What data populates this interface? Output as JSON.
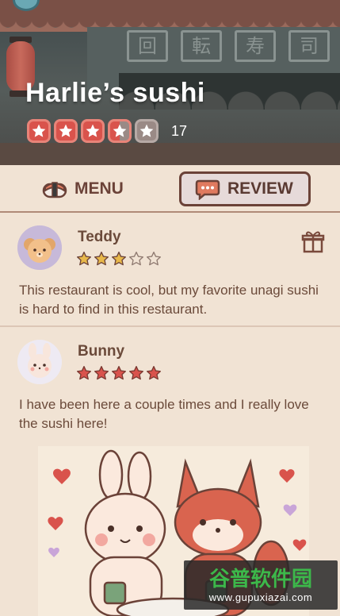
{
  "restaurant": {
    "name": "Harlie’s sushi",
    "rating": 3.5,
    "rating_max": 5,
    "rating_count": "17",
    "sign_chars": [
      "回",
      "転",
      "寿",
      "司"
    ]
  },
  "tabs": {
    "menu_label": "MENU",
    "review_label": "REVIEW",
    "active": "REVIEW"
  },
  "reviews": [
    {
      "name": "Teddy",
      "stars": 3,
      "text": "This restaurant is cool, but my favorite unagi sushi is hard to find in this restaurant."
    },
    {
      "name": "Bunny",
      "stars": 5,
      "text": "I have been here a couple times and I really love the sushi here!"
    }
  ],
  "watermark": {
    "title": "谷普软件园",
    "url": "www.gupuxiazai.com"
  },
  "colors": {
    "accent": "#d9534c",
    "background": "#f1e3d4",
    "text": "#6b4a3a"
  }
}
